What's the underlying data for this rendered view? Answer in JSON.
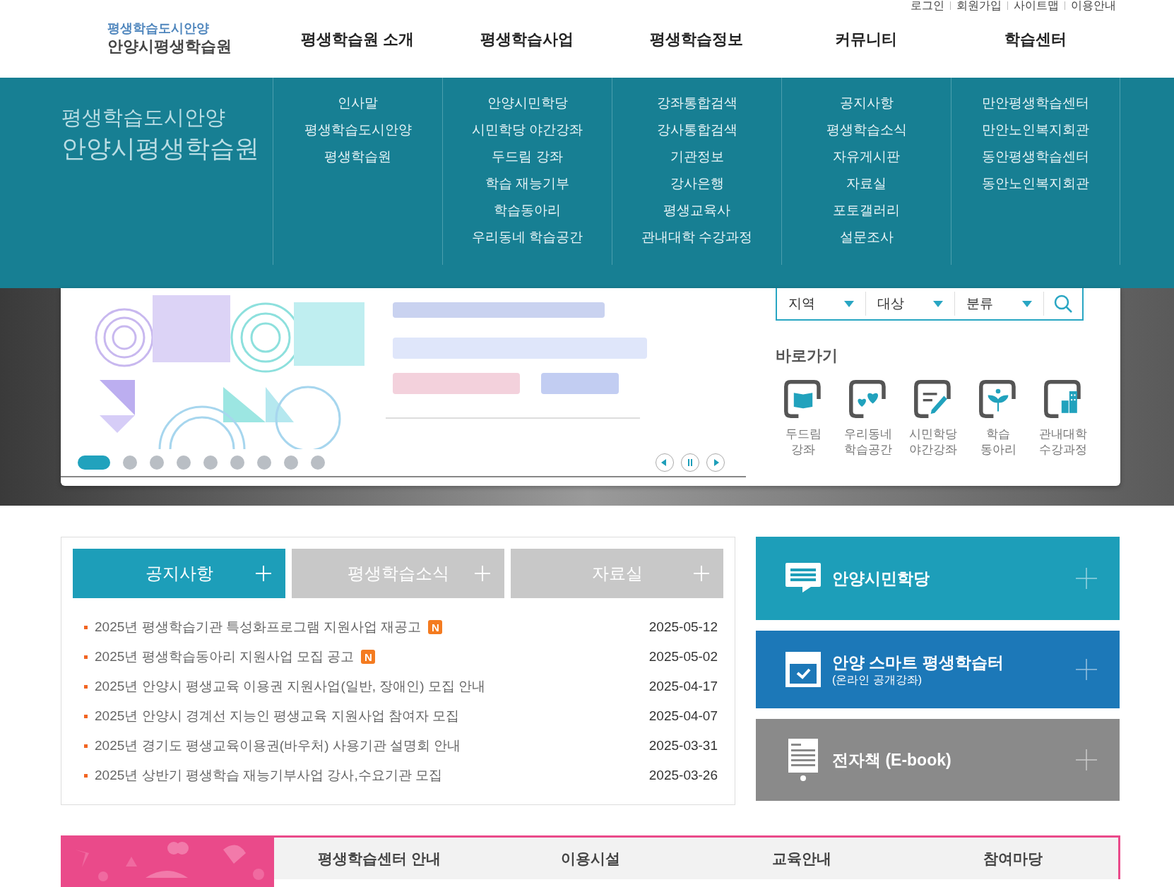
{
  "header": {
    "logo_subtitle": "평생학습도시안양",
    "logo_title": "안양시평생학습원",
    "utility_links": [
      "로그인",
      "회원가입",
      "사이트맵",
      "이용안내"
    ]
  },
  "nav": [
    {
      "label": "평생학습원 소개",
      "items": [
        "인사말",
        "평생학습도시안양",
        "평생학습원"
      ]
    },
    {
      "label": "평생학습사업",
      "items": [
        "안양시민학당",
        "시민학당 야간강좌",
        "두드림 강좌",
        "학습 재능기부",
        "학습동아리",
        "우리동네 학습공간"
      ]
    },
    {
      "label": "평생학습정보",
      "items": [
        "강좌통합검색",
        "강사통합검색",
        "기관정보",
        "강사은행",
        "평생교육사",
        "관내대학 수강과정"
      ]
    },
    {
      "label": "커뮤니티",
      "items": [
        "공지사항",
        "평생학습소식",
        "자유게시판",
        "자료실",
        "포토갤러리",
        "설문조사"
      ]
    },
    {
      "label": "학습센터",
      "items": [
        "만안평생학습센터",
        "만안노인복지회관",
        "동안평생학습센터",
        "동안노인복지회관"
      ]
    }
  ],
  "mega_menu": {
    "subtitle": "평생학습도시안양",
    "title": "안양시평생학습원"
  },
  "banner": {
    "kind": "picture"
  },
  "slide_dots": [
    {
      "selected": true
    },
    {
      "selected": false
    },
    {
      "selected": false
    },
    {
      "selected": false
    },
    {
      "selected": false
    },
    {
      "selected": false
    },
    {
      "selected": false
    },
    {
      "selected": false
    },
    {
      "selected": false
    }
  ],
  "search": {
    "selects": [
      "지역",
      "대상",
      "분류"
    ]
  },
  "quick_links": {
    "title": "바로가기",
    "items": [
      {
        "kind": "book",
        "lines": [
          "두드림",
          "강좌"
        ]
      },
      {
        "kind": "hearts",
        "lines": [
          "우리동네",
          "학습공간"
        ]
      },
      {
        "kind": "pencil",
        "lines": [
          "시민학당",
          "야간강좌"
        ]
      },
      {
        "kind": "sprout",
        "lines": [
          "학습",
          "동아리"
        ]
      },
      {
        "kind": "building",
        "lines": [
          "관내대학",
          "수강과정"
        ]
      }
    ]
  },
  "board": {
    "tabs": [
      {
        "label": "공지사항",
        "selected": true
      },
      {
        "label": "평생학습소식",
        "selected": false
      },
      {
        "label": "자료실",
        "selected": false
      }
    ],
    "posts": [
      {
        "title": "2025년 평생학습기관 특성화프로그램 지원사업 재공고",
        "new_badge": "N",
        "date": "2025-05-12"
      },
      {
        "title": "2025년 평생학습동아리 지원사업 모집 공고",
        "new_badge": "N",
        "date": "2025-05-02"
      },
      {
        "title": "2025년 안양시 평생교육 이용권 지원사업(일반, 장애인) 모집 안내",
        "date": "2025-04-17"
      },
      {
        "title": "2025년 안양시 경계선 지능인 평생교육 지원사업 참여자 모집",
        "date": "2025-04-07"
      },
      {
        "title": "2025년 경기도 평생교육이용권(바우처) 사용기관 설명회 안내",
        "date": "2025-03-31"
      },
      {
        "title": "2025년 상반기 평생학습 재능기부사업 강사,수요기관 모집",
        "date": "2025-03-26"
      }
    ]
  },
  "service_cards": [
    {
      "kind": "chat",
      "title": "안양시민학당",
      "color": "#1d9eb9"
    },
    {
      "kind": "check",
      "title": "안양 스마트 평생학습터",
      "subtitle": "(온라인 공개강좌)",
      "color": "#1c78b8"
    },
    {
      "kind": "document",
      "title": "전자책 (E-book)",
      "color": "#8a8a8a"
    }
  ],
  "bottom_tabs": [
    "평생학습센터 안내",
    "이용시설",
    "교육안내",
    "참여마당"
  ]
}
